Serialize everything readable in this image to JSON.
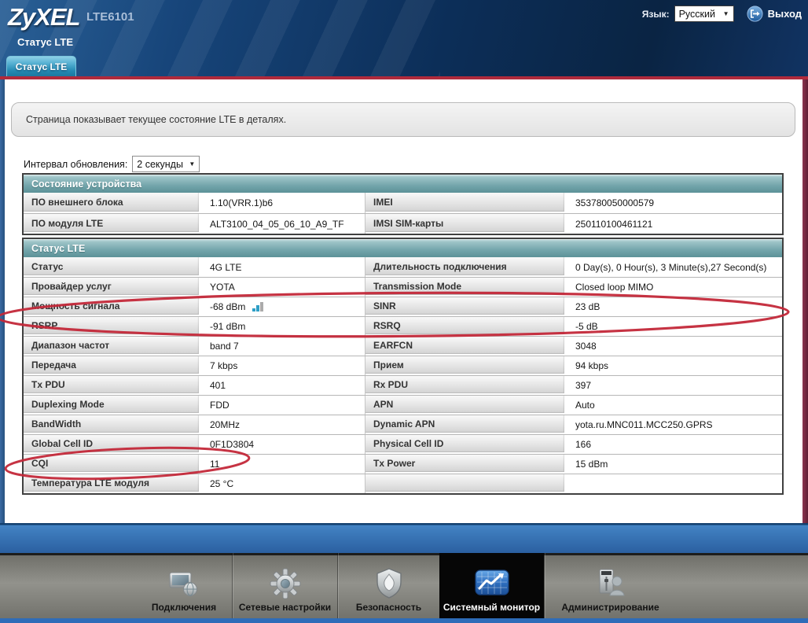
{
  "header": {
    "brand": "ZyXEL",
    "model": "LTE6101",
    "language_label": "Язык:",
    "language_value": "Русский",
    "logout_label": "Выход"
  },
  "page": {
    "title": "Статус LTE",
    "tab_label": "Статус LTE",
    "info_message": "Страница показывает текущее состояние LTE в деталях.",
    "interval_label": "Интервал обновления:",
    "interval_value": "2 секунды"
  },
  "device_table": {
    "title": "Состояние устройства",
    "rows": [
      {
        "l1": "ПО внешнего блока",
        "v1": "1.10(VRR.1)b6",
        "l2": "IMEI",
        "v2": "353780050000579"
      },
      {
        "l1": "ПО модуля LTE",
        "v1": "ALT3100_04_05_06_10_A9_TF",
        "l2": "IMSI SIM-карты",
        "v2": "250110100461121"
      }
    ]
  },
  "lte_table": {
    "title": "Статус LTE",
    "rows": [
      {
        "l1": "Статус",
        "v1": "4G LTE",
        "l2": "Длительность подключения",
        "v2": "0 Day(s), 0 Hour(s), 3 Minute(s),27 Second(s)"
      },
      {
        "l1": "Провайдер услуг",
        "v1": "YOTA",
        "l2": "Transmission Mode",
        "v2": "Closed loop MIMO"
      },
      {
        "l1": "Мощность сигнала",
        "v1": "-68 dBm",
        "l2": "SINR",
        "v2": "23 dB"
      },
      {
        "l1": "RSRP",
        "v1": "-91 dBm",
        "l2": "RSRQ",
        "v2": "-5 dB"
      },
      {
        "l1": "Диапазон частот",
        "v1": "band 7",
        "l2": "EARFCN",
        "v2": "3048"
      },
      {
        "l1": "Передача",
        "v1": "7 kbps",
        "l2": "Прием",
        "v2": "94 kbps"
      },
      {
        "l1": "Tx PDU",
        "v1": "401",
        "l2": "Rx PDU",
        "v2": "397"
      },
      {
        "l1": "Duplexing Mode",
        "v1": "FDD",
        "l2": "APN",
        "v2": "Auto"
      },
      {
        "l1": "BandWidth",
        "v1": "20MHz",
        "l2": "Dynamic APN",
        "v2": "yota.ru.MNC011.MCC250.GPRS"
      },
      {
        "l1": "Global Cell ID",
        "v1": "0F1D3804",
        "l2": "Physical Cell ID",
        "v2": "166"
      },
      {
        "l1": "CQI",
        "v1": "11",
        "l2": "Tx Power",
        "v2": "15 dBm"
      },
      {
        "l1": "Температура LTE модуля",
        "v1": "25 °C",
        "l2": "",
        "v2": ""
      }
    ]
  },
  "nav": {
    "items": [
      {
        "label": "Подключения",
        "icon": "connections-icon",
        "active": false
      },
      {
        "label": "Сетевые настройки",
        "icon": "network-settings-icon",
        "active": false
      },
      {
        "label": "Безопасность",
        "icon": "security-icon",
        "active": false
      },
      {
        "label": "Системный монитор",
        "icon": "system-monitor-icon",
        "active": true
      },
      {
        "label": "Администрирование",
        "icon": "administration-icon",
        "active": false
      }
    ]
  },
  "colors": {
    "header_blue": "#0c2e58",
    "accent_red_line": "#b02a3c",
    "tab_blue": "#2489b2",
    "table_header_teal": "#72a4aa",
    "annotation_red": "#c32839",
    "signal_bar_blue": "#2f9fc6",
    "nav_active_bg": "#060606",
    "bottom_strip_blue": "#2e6cb8"
  }
}
